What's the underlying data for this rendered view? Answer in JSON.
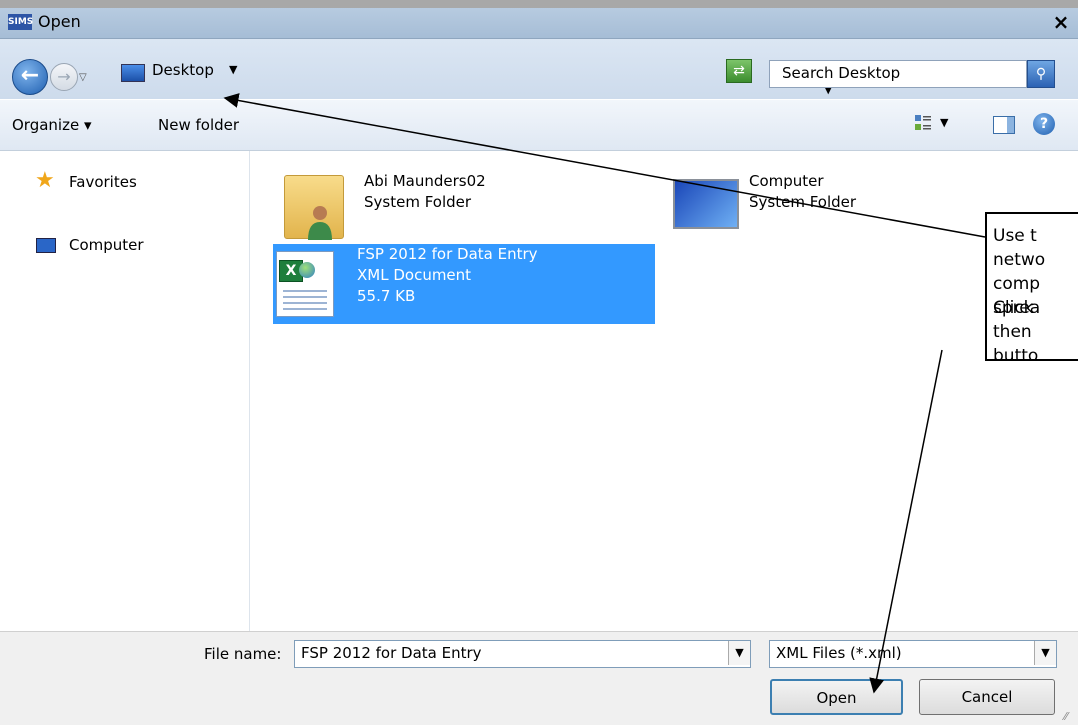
{
  "window": {
    "app_badge": "SIMS",
    "title": "Open",
    "close_glyph": "×"
  },
  "address_bar": {
    "location": "Desktop",
    "search_placeholder": "Search Desktop"
  },
  "toolbar": {
    "organize": "Organize ▾",
    "new_folder": "New folder"
  },
  "nav_pane": {
    "items": [
      {
        "label": "Favorites",
        "icon": "star-icon"
      },
      {
        "label": "Computer",
        "icon": "computer-icon"
      }
    ]
  },
  "files": [
    {
      "name": "Abi Maunders02",
      "type": "System Folder",
      "icon": "user-folder-icon"
    },
    {
      "name": "Computer",
      "type": "System Folder",
      "icon": "computer-icon"
    },
    {
      "name": "FSP 2012 for Data Entry",
      "type": "XML Document",
      "size": "55.7 KB",
      "icon": "excel-xml-icon",
      "selected": true
    }
  ],
  "callout": {
    "paragraph1": "Use t\nnetwo\ncomp\nsprea",
    "paragraph2": "Click\nthen\nbutto"
  },
  "bottom": {
    "file_name_label": "File name:",
    "file_name_value": "FSP 2012 for Data Entry",
    "file_type_value": "XML Files (*.xml)",
    "open_button": "Open",
    "cancel_button": "Cancel"
  },
  "colors": {
    "selection": "#3399ff",
    "titlebar": "#a6bdd6"
  }
}
